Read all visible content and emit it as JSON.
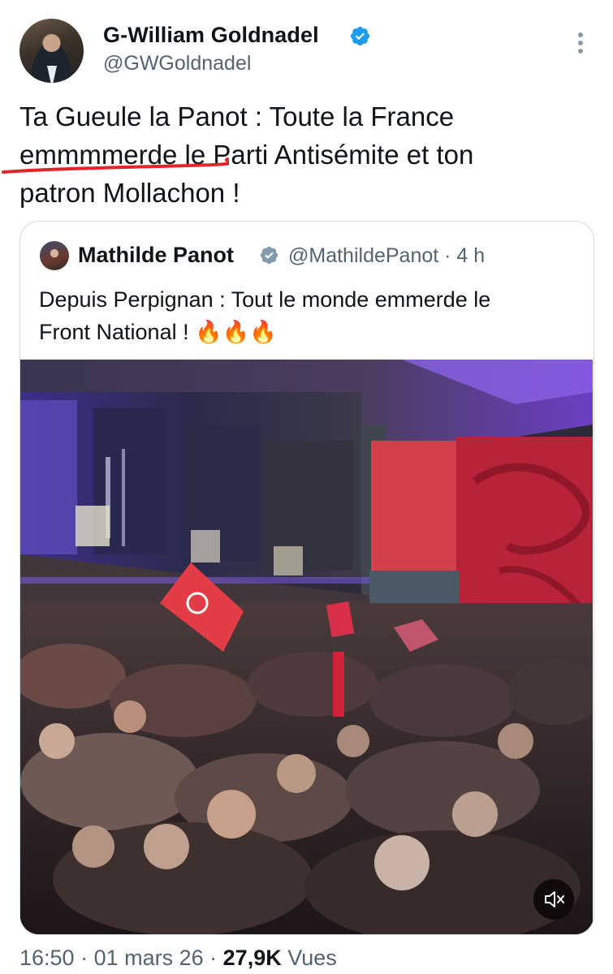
{
  "tweet": {
    "author": {
      "name": "G-William Goldnadel",
      "handle": "@GWGoldnadel",
      "verified": true
    },
    "text_lines": [
      "Ta Gueule la Panot : Toute la France",
      "emmmmerde le Parti Antisémite et ton",
      "patron Mollachon !"
    ],
    "quoted": {
      "author_name": "Mathilde Panot",
      "handle_time": "@MathildePanot · 4 h",
      "verified": true,
      "text_lines": [
        "Depuis Perpignan : Tout le monde emmerde le",
        "Front National ! 🔥🔥🔥"
      ],
      "media_icon": "speaker-muted-icon"
    },
    "meta": {
      "time": "16:50",
      "sep1": " · ",
      "date": "01 mars 26",
      "sep2": " · ",
      "views_count": "27,9K",
      "views_label": " Vues"
    }
  },
  "colors": {
    "text": "#0f1419",
    "secondary": "#536471",
    "verified_blue": "#1d9bf0",
    "annotation_red": "#e0262b",
    "card_border": "#cfd9de"
  }
}
